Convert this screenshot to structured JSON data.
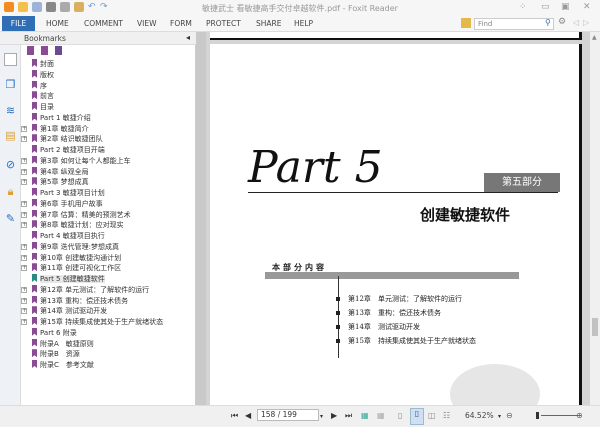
{
  "window": {
    "title": "敏捷武士 看敏捷高手交付卓越软件.pdf - Foxit Reader"
  },
  "ribbon": {
    "tabs": [
      "FILE",
      "HOME",
      "COMMENT",
      "VIEW",
      "FORM",
      "PROTECT",
      "SHARE",
      "HELP"
    ],
    "find_placeholder": "Find"
  },
  "bookmarks": {
    "title": "Bookmarks",
    "items": [
      {
        "label": "封面",
        "expandable": false
      },
      {
        "label": "版权",
        "expandable": false
      },
      {
        "label": "序",
        "expandable": false
      },
      {
        "label": "前言",
        "expandable": false
      },
      {
        "label": "目录",
        "expandable": false
      },
      {
        "label": "Part 1 敏捷介绍",
        "expandable": false
      },
      {
        "label": "第1章 敏捷简介",
        "expandable": true
      },
      {
        "label": "第2章 结识敏捷团队",
        "expandable": true
      },
      {
        "label": "Part 2 敏捷项目开端",
        "expandable": false
      },
      {
        "label": "第3章 如何让每个人都能上车",
        "expandable": true
      },
      {
        "label": "第4章 纵观全局",
        "expandable": true
      },
      {
        "label": "第5章 梦想成真",
        "expandable": true
      },
      {
        "label": "Part 3 敏捷项目计划",
        "expandable": false
      },
      {
        "label": "第6章 手机用户故事",
        "expandable": true
      },
      {
        "label": "第7章 估算：精美的预测艺术",
        "expandable": true
      },
      {
        "label": "第8章 敏捷计划：应对现实",
        "expandable": true
      },
      {
        "label": "Part 4 敏捷项目执行",
        "expandable": false
      },
      {
        "label": "第9章 迭代管理:梦想成真",
        "expandable": true
      },
      {
        "label": "第10章 创建敏捷沟通计划",
        "expandable": true
      },
      {
        "label": "第11章 创建可视化工作区",
        "expandable": true
      },
      {
        "label": "Part 5 创建敏捷软件",
        "expandable": false,
        "selected": true
      },
      {
        "label": "第12章 单元测试：了解软件的运行",
        "expandable": true
      },
      {
        "label": "第13章 重构：偿还技术债务",
        "expandable": true
      },
      {
        "label": "第14章 测试驱动开发",
        "expandable": true
      },
      {
        "label": "第15章 持续集成使其处于生产就绪状态",
        "expandable": true
      },
      {
        "label": "Part 6 附录",
        "expandable": false
      },
      {
        "label": "附录A　敏捷原则",
        "expandable": false
      },
      {
        "label": "附录B　资源",
        "expandable": false
      },
      {
        "label": "附录C　参考文献",
        "expandable": false
      }
    ]
  },
  "document": {
    "part_title": "Part 5",
    "part_label": "第五部分",
    "part_name": "创建敏捷软件",
    "contents_label": "本部分内容",
    "chapters": [
      {
        "num": "第12章",
        "title": "单元测试：了解软件的运行"
      },
      {
        "num": "第13章",
        "title": "重构：偿还技术债务"
      },
      {
        "num": "第14章",
        "title": "测试驱动开发"
      },
      {
        "num": "第15章",
        "title": "持续集成使其处于生产就绪状态"
      }
    ]
  },
  "status": {
    "page_display": "158 / 199",
    "current_page": 158,
    "total_pages": 199,
    "zoom": "64.52%"
  }
}
